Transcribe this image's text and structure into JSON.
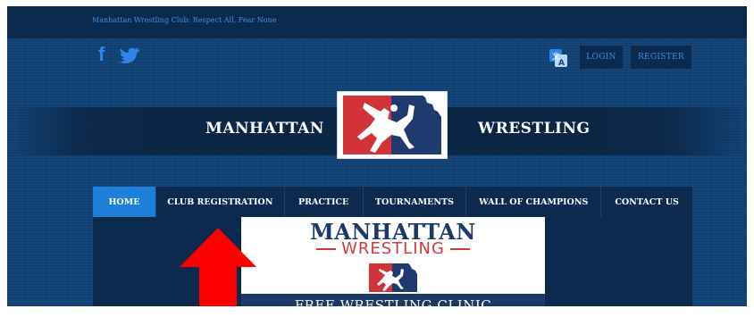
{
  "header": {
    "tagline": "Manhattan Wrestling Club: Respect All, Fear None",
    "social": [
      "facebook-icon",
      "twitter-icon"
    ],
    "translate_icon": "translate-icon",
    "login_label": "LOGIN",
    "register_label": "REGISTER"
  },
  "brand": {
    "left": "MANHATTAN",
    "right": "WRESTLING",
    "logo_colors": {
      "red": "#d0333a",
      "blue": "#1f3a6e"
    }
  },
  "nav": {
    "items": [
      {
        "label": "HOME",
        "active": true
      },
      {
        "label": "CLUB REGISTRATION",
        "active": false
      },
      {
        "label": "PRACTICE",
        "active": false
      },
      {
        "label": "TOURNAMENTS",
        "active": false
      },
      {
        "label": "WALL OF CHAMPIONS",
        "active": false
      },
      {
        "label": "CONTACT US",
        "active": false
      }
    ]
  },
  "banner": {
    "title": "MANHATTAN",
    "subtitle": "WRESTLING",
    "strip_text": "FREE WRESTLING CLINIC"
  },
  "annotation": {
    "arrow_color": "#ff0000",
    "arrow_icon": "up-arrow-icon"
  },
  "colors": {
    "background": "#13477e",
    "dark": "#0c2a4d",
    "accent": "#1e7fd9"
  }
}
